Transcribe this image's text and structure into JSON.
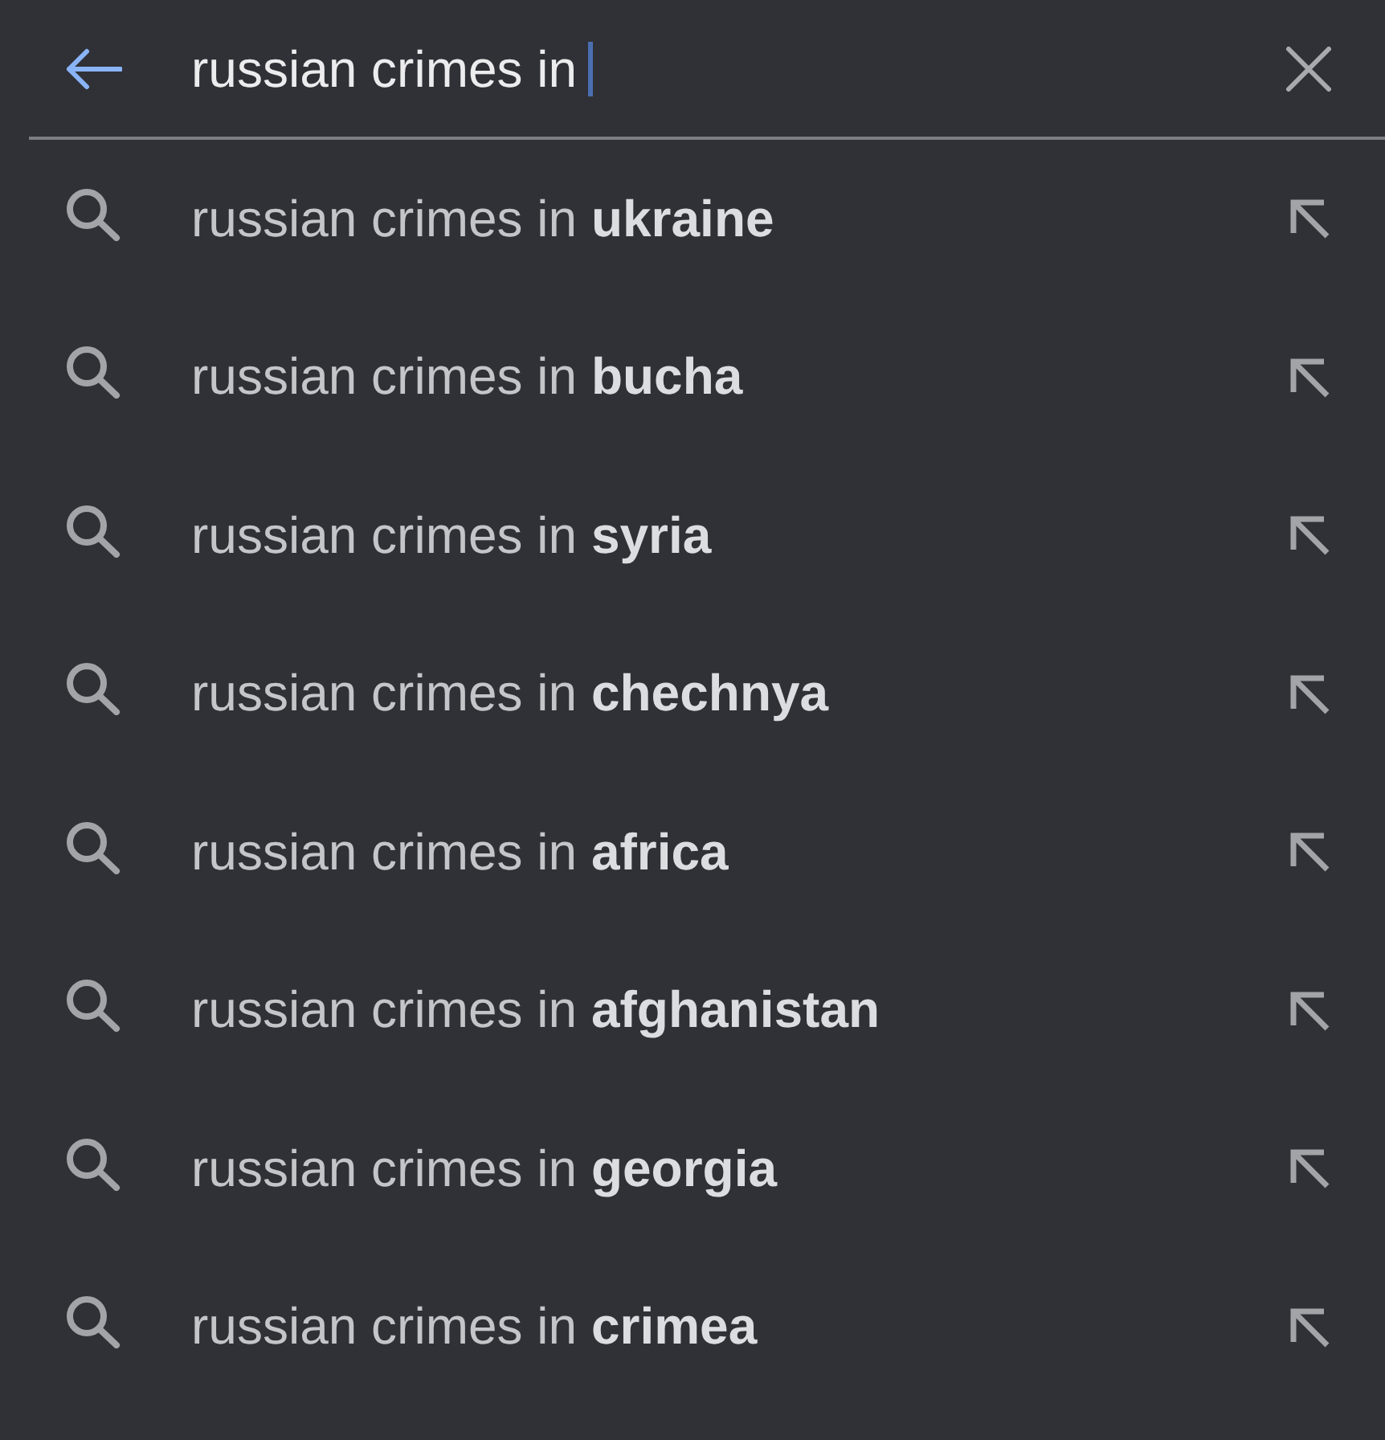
{
  "search_bar": {
    "query": "russian crimes in"
  },
  "suggestions": [
    {
      "text": "russian crimes in **ukraine**"
    },
    {
      "text": "russian crimes in **bucha**"
    },
    {
      "text": "russian crimes in **syria**"
    },
    {
      "text": "russian crimes in **chechnya**"
    },
    {
      "text": "russian crimes in **africa**"
    },
    {
      "text": "russian crimes in **afghanistan**"
    },
    {
      "text": "russian crimes in **georgia**"
    },
    {
      "text": "russian crimes in **crimea**"
    }
  ]
}
